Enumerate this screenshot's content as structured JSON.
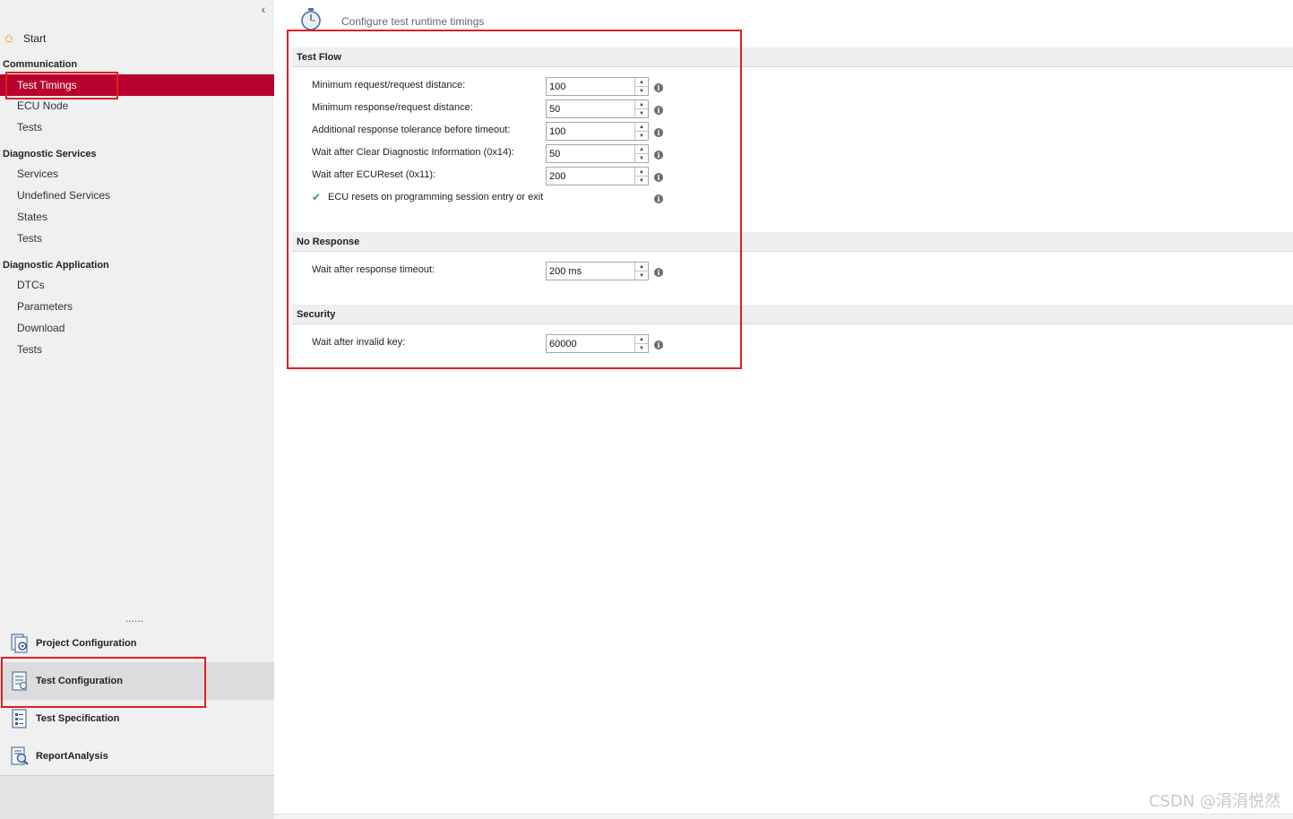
{
  "sidebar": {
    "start_label": "Start",
    "groups": [
      {
        "title": "Communication",
        "items": [
          "Test Timings",
          "ECU Node",
          "Tests"
        ]
      },
      {
        "title": "Diagnostic  Services",
        "items": [
          "Services",
          "Undefined Services",
          "States",
          "Tests"
        ]
      },
      {
        "title": "Diagnostic  Application",
        "items": [
          "DTCs",
          "Parameters",
          "Download",
          "Tests"
        ]
      }
    ],
    "selected_item": "Test Timings",
    "grip": "......",
    "bottom_nav": [
      {
        "label": "Project Configuration",
        "icon": "project-config-icon"
      },
      {
        "label": "Test Configuration",
        "icon": "test-config-icon"
      },
      {
        "label": "Test Specification",
        "icon": "test-spec-icon"
      },
      {
        "label": "ReportAnalysis",
        "icon": "report-analysis-icon"
      }
    ],
    "selected_bottom": "Test Configuration"
  },
  "main": {
    "header": "Configure test runtime timings",
    "test_flow": {
      "title": "Test Flow",
      "rows": [
        {
          "label": "Minimum request/request distance:",
          "value": "100"
        },
        {
          "label": "Minimum response/request distance:",
          "value": "50"
        },
        {
          "label": "Additional response tolerance before timeout:",
          "value": "100"
        },
        {
          "label": "Wait after Clear Diagnostic Information (0x14):",
          "value": "50"
        },
        {
          "label": "Wait after ECUReset (0x11):",
          "value": "200"
        }
      ],
      "checkbox_label": "ECU resets on programming session entry or exit"
    },
    "no_response": {
      "title": "No Response",
      "rows": [
        {
          "label": "Wait after response timeout:",
          "value": "200 ms"
        }
      ]
    },
    "security": {
      "title": "Security",
      "rows": [
        {
          "label": "Wait after invalid key:",
          "value": "60000"
        }
      ]
    }
  },
  "watermark": "CSDN @涓涓悦然",
  "colors": {
    "selection": "#b8002e",
    "annotation": "#e0201f"
  }
}
